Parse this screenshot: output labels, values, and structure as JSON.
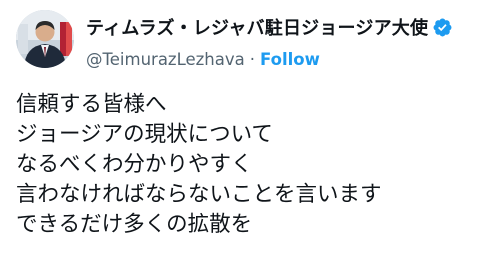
{
  "author": {
    "display_name": "ティムラズ・レジャバ駐日ジョージア大使",
    "handle": "@TeimurazLezhava",
    "separator": "·",
    "follow_label": "Follow",
    "verified": true,
    "verified_color": "#1d9bf0"
  },
  "tweet": {
    "lines": [
      "信頼する皆様へ",
      "ジョージアの現状について",
      "なるべくわ分かりやすく",
      "言わなければならないことを言います",
      "できるだけ多くの拡散を"
    ]
  },
  "colors": {
    "text": "#0f1419",
    "secondary": "#536471",
    "accent": "#1d9bf0"
  },
  "icons": {
    "verified": "verified-badge-icon",
    "avatar": "profile-avatar"
  }
}
